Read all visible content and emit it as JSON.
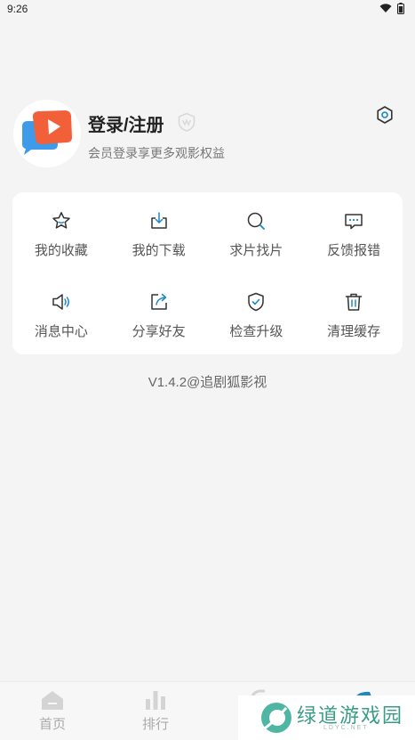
{
  "status_bar": {
    "time": "9:26"
  },
  "profile": {
    "login_label": "登录/注册",
    "subtitle": "会员登录享更多观影权益"
  },
  "menu": {
    "items": [
      {
        "label": "我的收藏",
        "icon": "star-icon"
      },
      {
        "label": "我的下载",
        "icon": "download-icon"
      },
      {
        "label": "求片找片",
        "icon": "search-icon"
      },
      {
        "label": "反馈报错",
        "icon": "feedback-icon"
      },
      {
        "label": "消息中心",
        "icon": "speaker-icon"
      },
      {
        "label": "分享好友",
        "icon": "share-icon"
      },
      {
        "label": "检查升级",
        "icon": "shield-check-icon"
      },
      {
        "label": "清理缓存",
        "icon": "trash-icon"
      }
    ]
  },
  "version": "V1.4.2@追剧狐影视",
  "bottom_nav": {
    "items": [
      {
        "label": "首页",
        "icon": "home-icon"
      },
      {
        "label": "排行",
        "icon": "rank-icon"
      }
    ]
  },
  "watermark": {
    "text": "绿道游戏园",
    "sub": "LDYC.NET"
  },
  "colors": {
    "accent": "#1e88c7",
    "icon_dark": "#333333",
    "background": "#f4f4f4"
  }
}
